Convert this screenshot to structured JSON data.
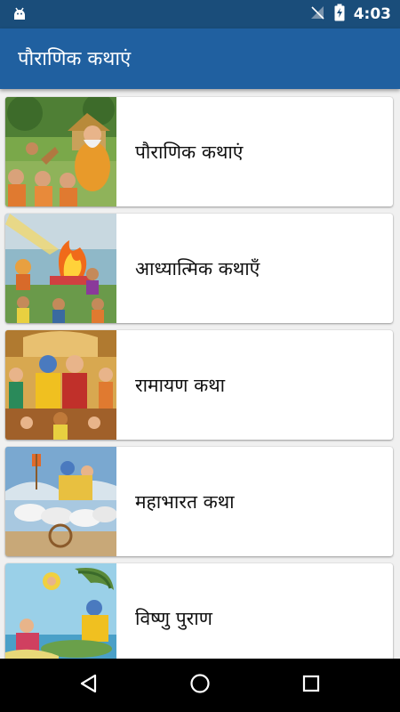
{
  "status_bar": {
    "time": "4:03",
    "background": "#1a4d7a"
  },
  "app_bar": {
    "title": "पौराणिक कथाएं",
    "background": "#2060a0"
  },
  "categories": [
    {
      "label": "पौराणिक कथाएं",
      "image": "sage-teaching-disciples"
    },
    {
      "label": "आध्यात्मिक कथाएँ",
      "image": "sacred-fire-yajna"
    },
    {
      "label": "रामायण कथा",
      "image": "ram-darbar"
    },
    {
      "label": "महाभारत कथा",
      "image": "krishna-arjuna-chariot"
    },
    {
      "label": "विष्णु पुराण",
      "image": "vishnu-on-sheshnag"
    }
  ],
  "nav_bar": {
    "back_icon": "back-triangle",
    "home_icon": "home-circle",
    "recents_icon": "recents-square"
  }
}
